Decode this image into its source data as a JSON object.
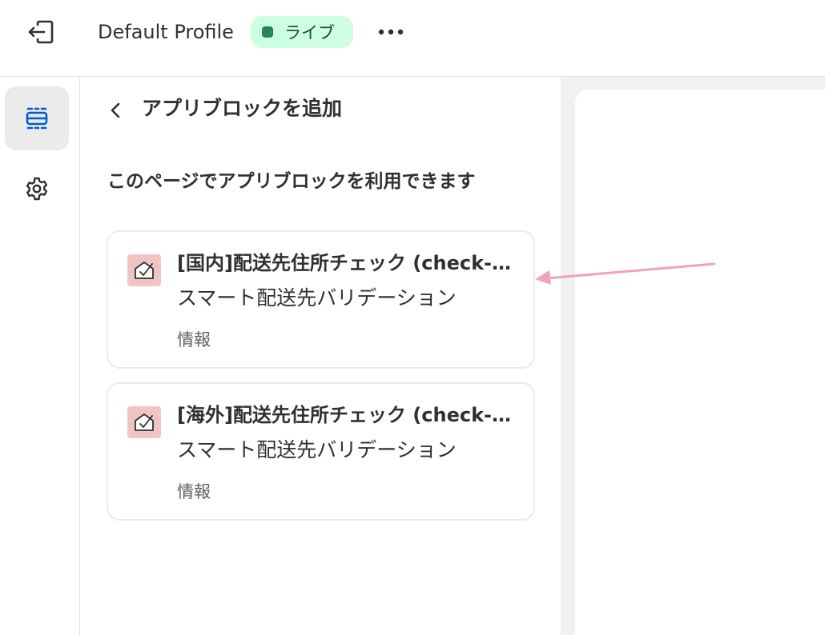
{
  "topbar": {
    "exit_icon": "exit-icon",
    "profile_name": "Default Profile",
    "status_label": "ライブ",
    "status_color": "#29845a",
    "more_icon": "more-horizontal-icon"
  },
  "rail": {
    "items": [
      {
        "icon": "sections-icon",
        "active": true
      },
      {
        "icon": "gear-icon",
        "active": false
      }
    ]
  },
  "panel": {
    "title": "アプリブロックを追加",
    "section_heading": "このページでアプリブロックを利用できます",
    "cards": [
      {
        "title": "[国内]配送先住所チェック (check-address)",
        "subtitle": "スマート配送先バリデーション",
        "tag": "情報"
      },
      {
        "title": "[海外]配送先住所チェック (check-address)",
        "subtitle": "スマート配送先バリデーション",
        "tag": "情報"
      }
    ]
  },
  "annotation": {
    "arrow_color": "#f0a3bf"
  }
}
